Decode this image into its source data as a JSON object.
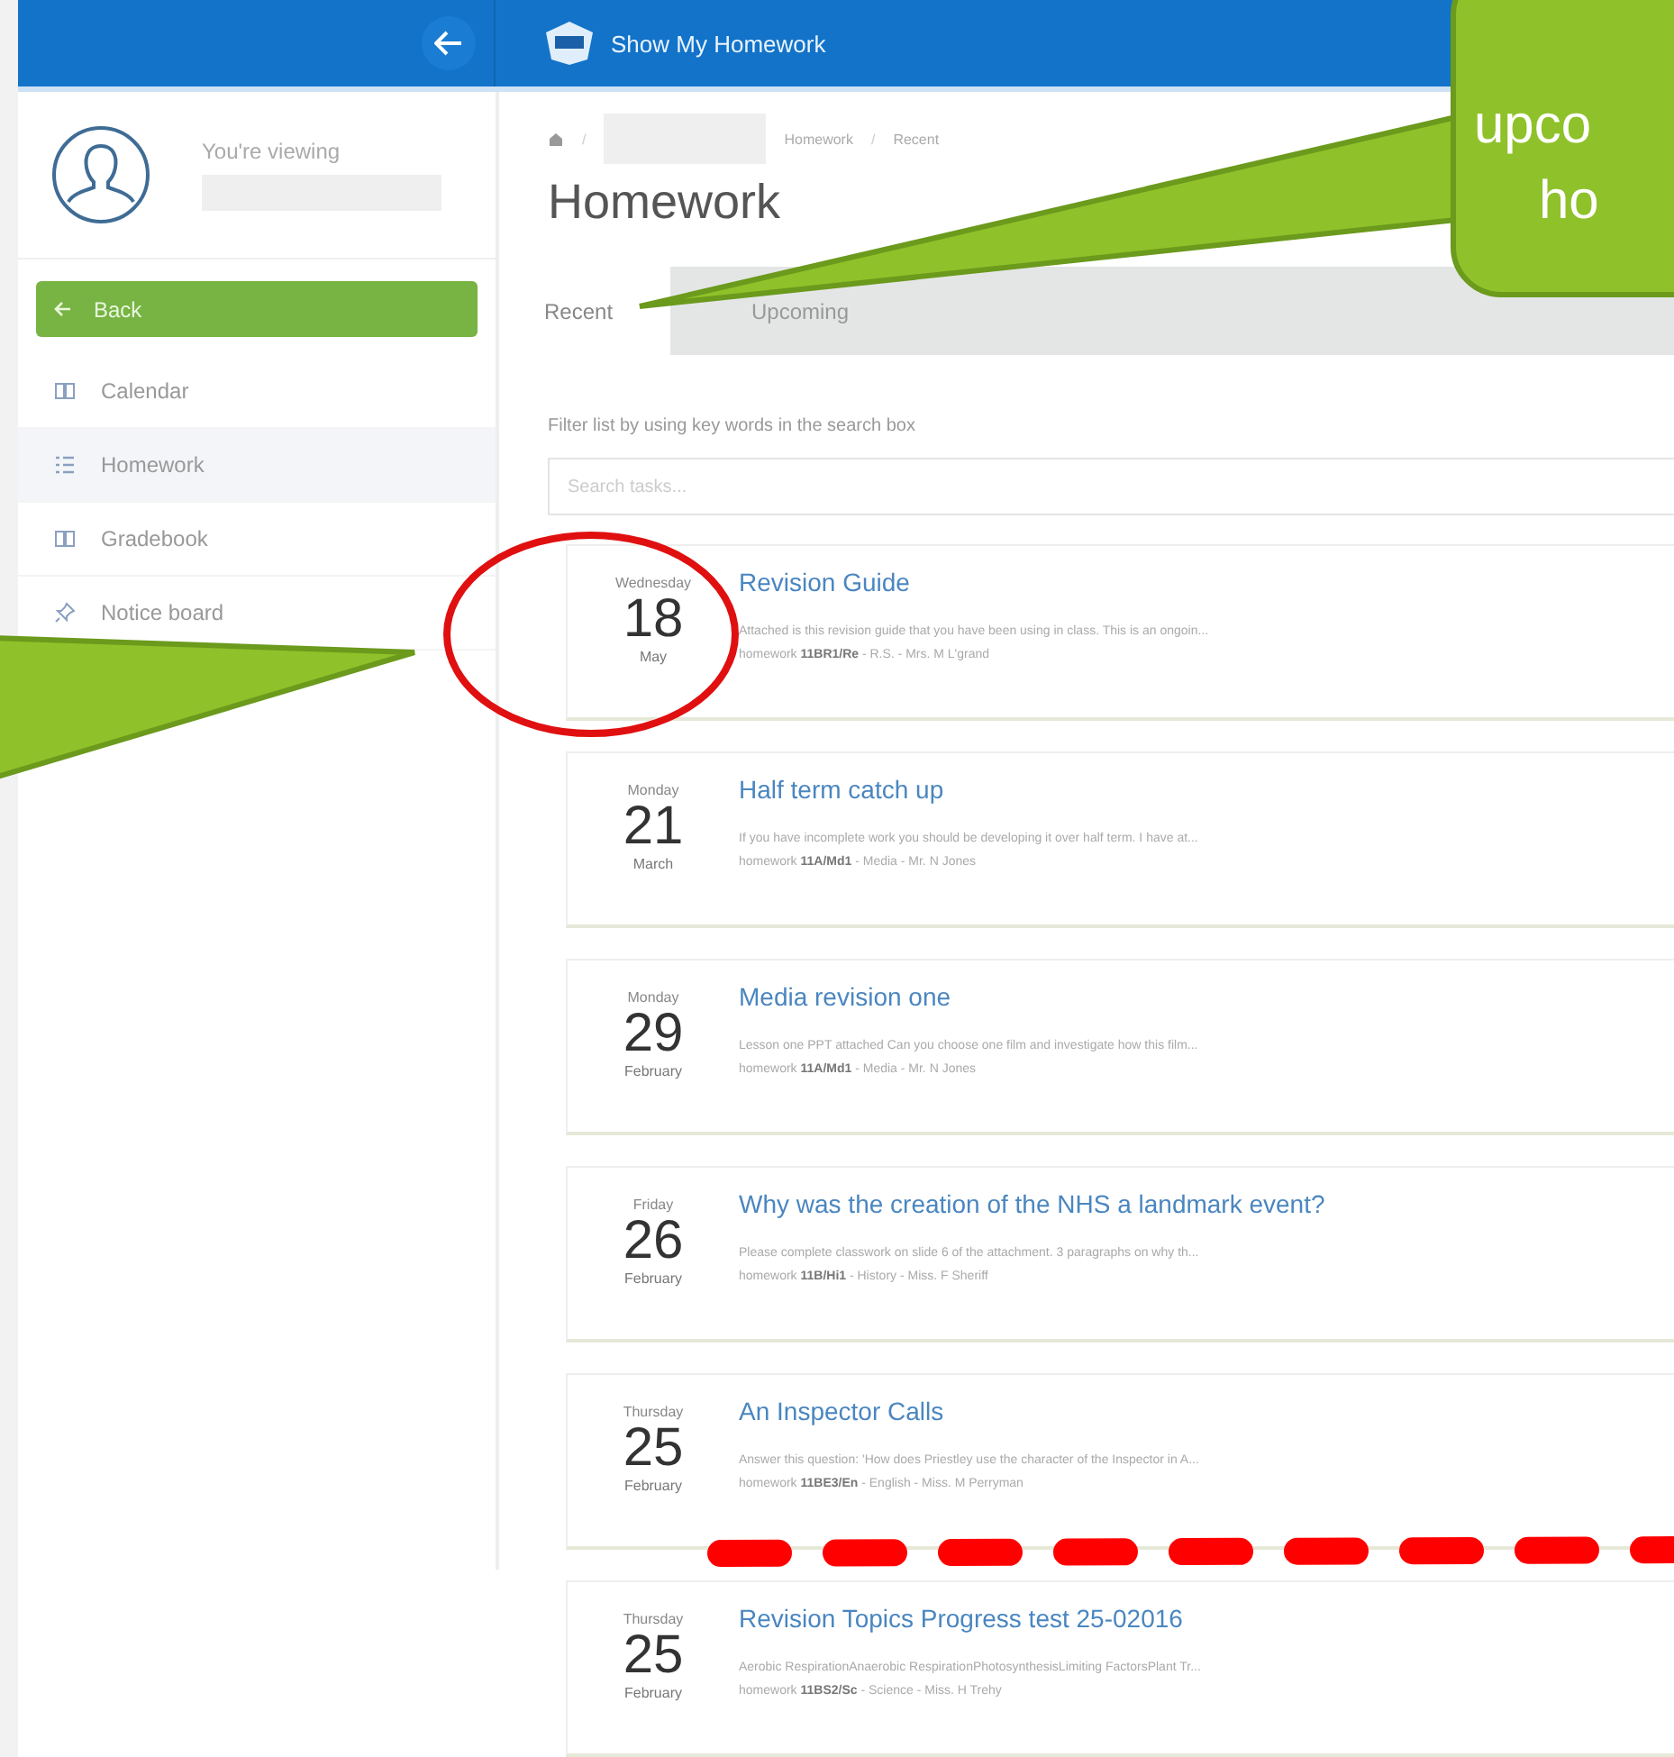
{
  "header": {
    "title": "Show My Homework"
  },
  "profile": {
    "viewing_label": "You're viewing"
  },
  "sidebar": {
    "back": "Back",
    "items": [
      {
        "label": "Calendar",
        "kind": "book",
        "selected": false
      },
      {
        "label": "Homework",
        "kind": "list",
        "selected": true
      },
      {
        "label": "Gradebook",
        "kind": "book",
        "selected": false
      },
      {
        "label": "Notice board",
        "kind": "pin",
        "selected": false
      }
    ]
  },
  "breadcrumb": [
    {
      "kind": "separator",
      "text": "/"
    },
    {
      "kind": "redacted"
    },
    {
      "kind": "link",
      "text": "Homework"
    },
    {
      "kind": "separator",
      "text": "/"
    },
    {
      "kind": "link",
      "text": "Recent"
    }
  ],
  "page_title": "Homework",
  "tabs": [
    {
      "label": "Recent",
      "selected": true
    },
    {
      "label": "Upcoming",
      "selected": false
    }
  ],
  "filter_hint": "Filter list by using key words in the search box",
  "search": {
    "placeholder": "Search tasks..."
  },
  "tasks": [
    {
      "weekday": "Wednesday",
      "day": "18",
      "month": "May",
      "title": "Revision Guide",
      "description": "Attached is this revision guide that you have been using in class. This is an ongoin...",
      "meta": "homework **11BR1/Re** - R.S. - Mrs. M L'grand"
    },
    {
      "weekday": "Monday",
      "day": "21",
      "month": "March",
      "title": "Half term catch up",
      "description": "If you have incomplete work you should be developing it over half term. I have at...",
      "meta": "homework **11A/Md1** - Media - Mr. N Jones"
    },
    {
      "weekday": "Monday",
      "day": "29",
      "month": "February",
      "title": "Media revision one",
      "description": "Lesson one PPT attached Can you choose one film and investigate how this film...",
      "meta": "homework **11A/Md1** - Media - Mr. N Jones"
    },
    {
      "weekday": "Friday",
      "day": "26",
      "month": "February",
      "title": "Why was the creation of the NHS a landmark event?",
      "description": "Please complete classwork on slide 6 of the attachment. 3 paragraphs on why th...",
      "meta": "homework **11B/Hi1** - History - Miss. F Sheriff"
    },
    {
      "weekday": "Thursday",
      "day": "25",
      "month": "February",
      "title": "An Inspector Calls",
      "description": "Answer this question: 'How does Priestley use the character of the Inspector in A...",
      "meta": "homework **11BE3/En** - English - Miss. M Perryman"
    },
    {
      "weekday": "Thursday",
      "day": "25",
      "month": "February",
      "title": "Revision Topics Progress test 25-02016",
      "description": "Aerobic RespirationAnaerobic RespirationPhotosynthesisLimiting FactorsPlant Tr...",
      "meta": "homework **11BS2/Sc** - Science - Miss. H Trehy"
    }
  ],
  "annotations": {
    "callout_lines": [
      "upco",
      "ho"
    ]
  }
}
